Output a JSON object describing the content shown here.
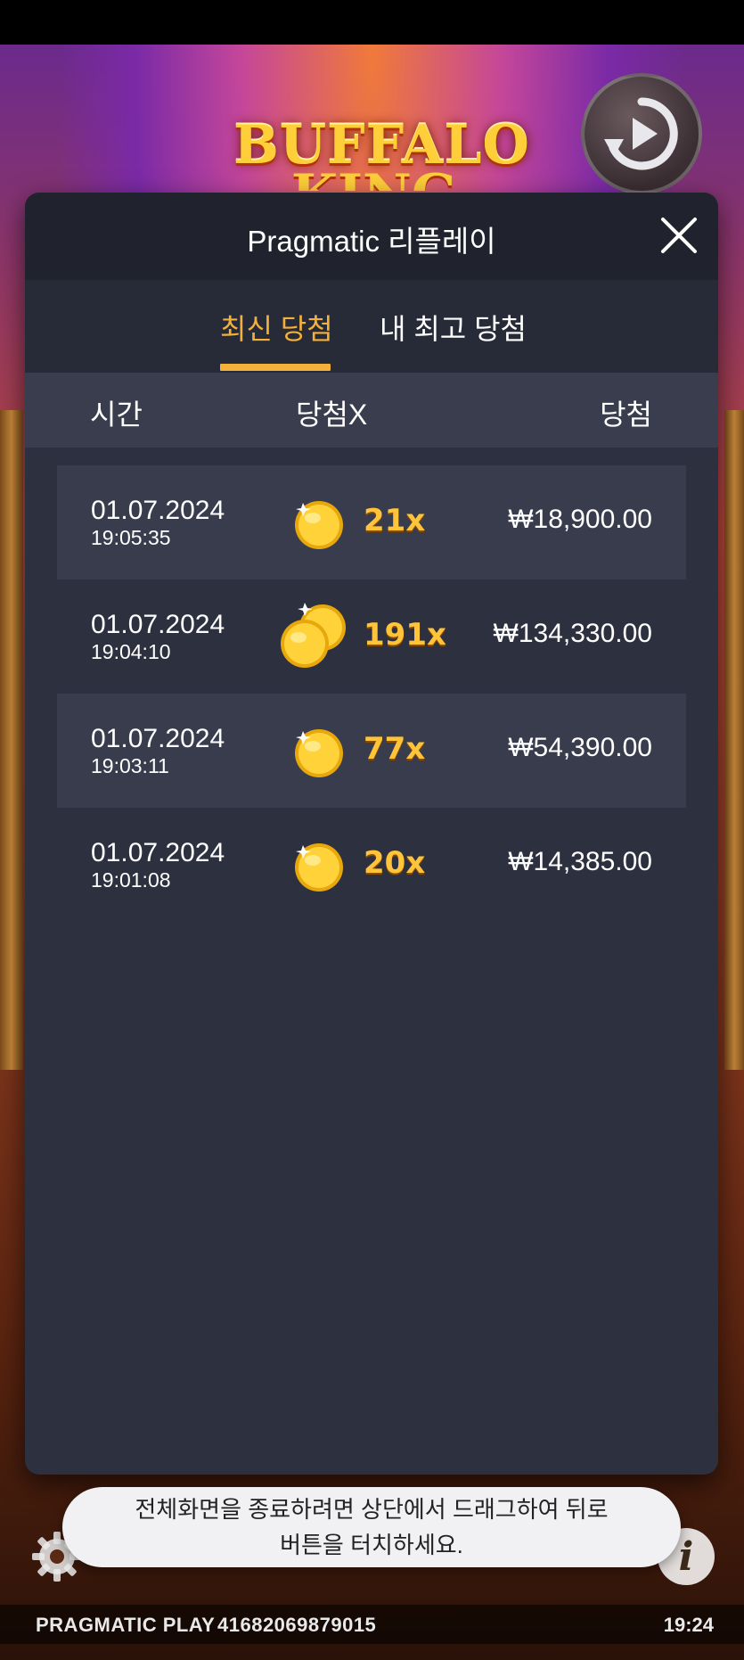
{
  "game": {
    "title": "BUFFALO",
    "subtitle": "KING"
  },
  "modal": {
    "title": "Pragmatic 리플레이",
    "tabs": [
      {
        "label": "최신 당첨",
        "active": true
      },
      {
        "label": "내 최고 당첨",
        "active": false
      }
    ],
    "columns": {
      "time": "시간",
      "multiplier": "당첨X",
      "win": "당첨"
    },
    "rows": [
      {
        "date": "01.07.2024",
        "time": "19:05:35",
        "coins": "single-coin-icon",
        "multiplier": "21x",
        "win": "₩18,900.00"
      },
      {
        "date": "01.07.2024",
        "time": "19:04:10",
        "coins": "double-coin-icon",
        "multiplier": "191x",
        "win": "₩134,330.00"
      },
      {
        "date": "01.07.2024",
        "time": "19:03:11",
        "coins": "single-coin-icon",
        "multiplier": "77x",
        "win": "₩54,390.00"
      },
      {
        "date": "01.07.2024",
        "time": "19:01:08",
        "coins": "single-coin-icon",
        "multiplier": "20x",
        "win": "₩14,385.00"
      }
    ]
  },
  "toast": {
    "line1": "전체화면을 종료하려면 상단에서 드래그하여 뒤로",
    "line2": "버튼을 터치하세요."
  },
  "footer": {
    "brand": "PRAGMATIC PLAY",
    "session_id": "41682069879015",
    "clock": "19:24"
  },
  "colors": {
    "accent": "#f3b03a",
    "modal_bg": "#2d303f",
    "header_bg": "#20232e"
  }
}
